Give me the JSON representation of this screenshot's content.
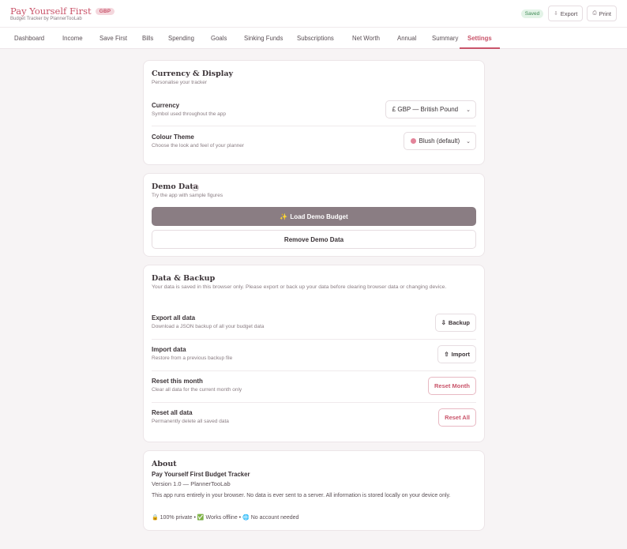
{
  "header": {
    "app_title": "Pay Yourself First",
    "currency_badge": "GBP",
    "subtitle": "Budget Tracker by PlannerTooLab",
    "saved_badge": "Saved",
    "export_label": "Export",
    "print_label": "Print"
  },
  "nav": {
    "items": [
      "Dashboard",
      "Income",
      "Save First",
      "Bills",
      "Spending",
      "Goals",
      "Sinking Funds",
      "Subscriptions",
      "Net Worth",
      "Annual",
      "Summary",
      "Settings"
    ],
    "active": "Settings"
  },
  "currency_display": {
    "title": "Currency & Display",
    "subtitle": "Personalise your tracker",
    "currency_label": "Currency",
    "currency_desc": "Symbol used throughout the app",
    "currency_value": "£ GBP — British Pound",
    "theme_label": "Colour Theme",
    "theme_desc": "Choose the look and feel of your planner",
    "theme_value": "Blush (default)",
    "theme_color": "#e3849a"
  },
  "demo_data": {
    "title": "Demo Data",
    "help": "?",
    "subtitle": "Try the app with sample figures",
    "load_label": "Load Demo Budget",
    "load_icon": "✨",
    "remove_label": "Remove Demo Data"
  },
  "backup": {
    "title": "Data & Backup",
    "description": "Your data is saved in this browser only. Please export or back up your data before clearing browser data or changing device.",
    "export_title": "Export all data",
    "export_desc": "Download a JSON backup of all your budget data",
    "export_button": "Backup",
    "import_title": "Import data",
    "import_desc": "Restore from a previous backup file",
    "import_button": "Import",
    "reset_month_title": "Reset this month",
    "reset_month_desc": "Clear all data for the current month only",
    "reset_month_button": "Reset Month",
    "reset_all_title": "Reset all data",
    "reset_all_desc": "Permanently delete all saved data",
    "reset_all_button": "Reset All"
  },
  "about": {
    "title": "About",
    "app_name": "Pay Yourself First Budget Tracker",
    "version": "Version 1.0 — PlannerTooLab",
    "description": "This app runs entirely in your browser. No data is ever sent to a server. All information is stored locally on your device only.",
    "features": "🔒 100% private • ✅ Works offline • 🌐 No account needed"
  },
  "colors": {
    "accent": "#c9546a",
    "background": "#f7f4f5",
    "primary_button": "#8a7d83"
  }
}
